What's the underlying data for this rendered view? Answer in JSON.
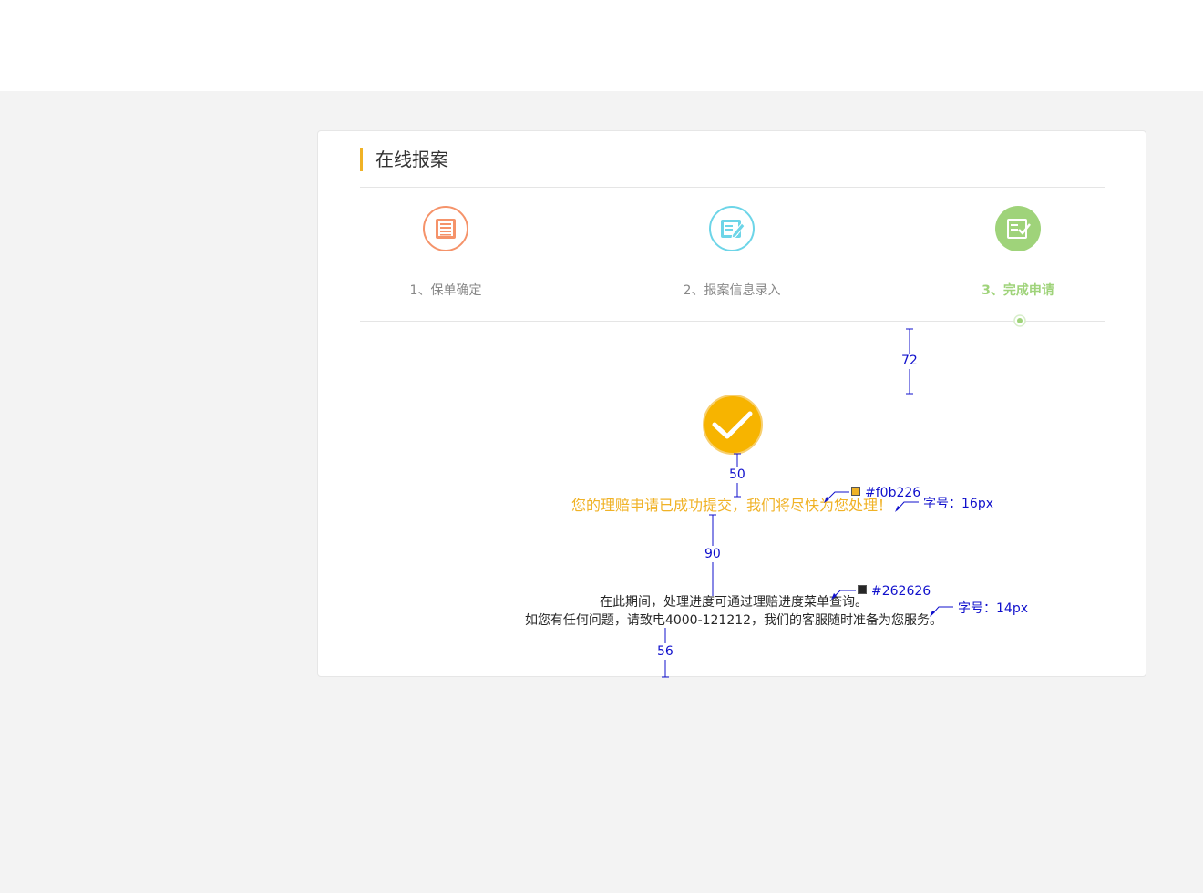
{
  "page": {
    "title": "在线报案"
  },
  "steps": [
    {
      "label": "1、保单确定",
      "icon": "document-list-icon",
      "color": "#f5936a"
    },
    {
      "label": "2、报案信息录入",
      "icon": "edit-form-icon",
      "color": "#6dd5e8"
    },
    {
      "label": "3、完成申请",
      "icon": "checked-form-icon",
      "color": "#9fd37a",
      "active": true
    }
  ],
  "result": {
    "icon": "check-circle-icon",
    "message": "您的理赔申请已成功提交，我们将尽快为您处理！",
    "info_line1": "在此期间，处理进度可通过理赔进度菜单查询。",
    "info_line2": "如您有任何问题，请致电4000-121212，我们的客服随时准备为您服务。"
  },
  "annotations": {
    "spacing_72": "72",
    "spacing_50": "50",
    "spacing_90": "90",
    "spacing_56": "56",
    "msg_color": "#f0b226",
    "msg_font": "字号：16px",
    "info_color": "#262626",
    "info_font": "字号：14px"
  },
  "colors": {
    "accent": "#f0b226",
    "text": "#262626",
    "active_step": "#9fd37a",
    "annotation": "#1010cc"
  }
}
